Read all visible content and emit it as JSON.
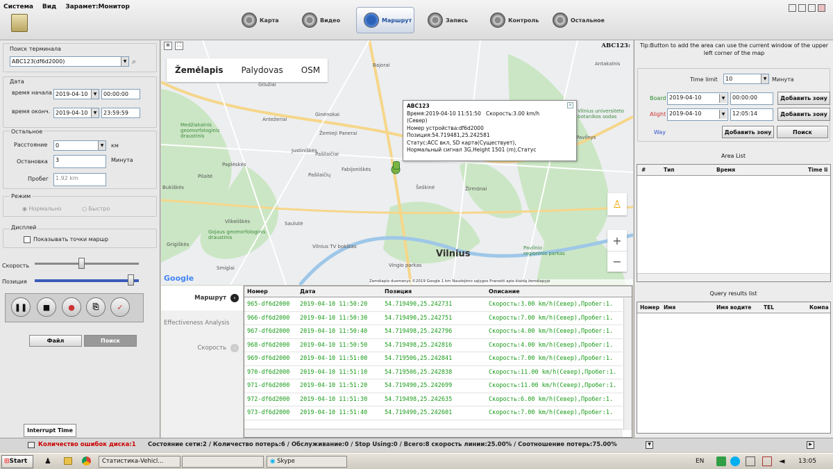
{
  "menu": {
    "items": [
      "Система",
      "Вид",
      "Зарамет:Монитор"
    ]
  },
  "nav": {
    "items": [
      {
        "label": "Карта",
        "active": false
      },
      {
        "label": "Видео",
        "active": false
      },
      {
        "label": "Маршрут",
        "active": true
      },
      {
        "label": "Запись",
        "active": false
      },
      {
        "label": "Контроль",
        "active": false
      },
      {
        "label": "Остальное",
        "active": false
      }
    ]
  },
  "left": {
    "search_label": "Поиск терминала",
    "terminal_value": "ABC123(df6d2000)",
    "date_group": "Дата",
    "start_label": "время начала",
    "start_date": "2019-04-10",
    "start_time": "00:00:00",
    "end_label": "время оконч.",
    "end_date": "2019-04-10",
    "end_time": "23:59:59",
    "other_group": "Остальное",
    "distance_label": "Расстояние",
    "distance_value": "0",
    "distance_unit": "км",
    "stop_label": "Остановка",
    "stop_value": "3",
    "stop_unit": "Минута",
    "mileage_label": "Пробег",
    "mileage_value": "1.92 km",
    "mode_group": "Режим",
    "mode_normal": "Нормально",
    "mode_fast": "Быстро",
    "display_group": "Дисплей",
    "show_points": "Показывать точки маршр",
    "speed_label": "Скорость",
    "position_label": "Позиция",
    "file_button": "Файл",
    "search_button": "Поиск",
    "interrupt_tab": "Interrupt Time"
  },
  "map": {
    "tabs": [
      "Žemėlapis",
      "Palydovas",
      "OSM"
    ],
    "vehicle_label": "ABC123:",
    "city": "Vilnius",
    "footer": "Žemėlapio duomenys ©2019 Google    1 km           Naudojimo sąlygos    Pranešti apie klaidą žemėlapyje",
    "google": "Google",
    "places": [
      "Bajorai",
      "Gilužiai",
      "Antežeriai",
      "Ginėnokai",
      "Žemieji Panerai",
      "Pašilaičiai",
      "Justiniškės",
      "Paplėskės",
      "Fabijoniškės",
      "Pilaitė",
      "Pašilaičių",
      "Bukiškės",
      "Pavilnys",
      "Vilkeliškės",
      "Šeškinė",
      "Žirmūnai",
      "Saulutė",
      "Vilnius TV bokštas",
      "Grigiškės",
      "Gojaus geomorfologinis draustinis",
      "Vingio parkas",
      "Pavilnio regioninis parkas",
      "Smiglai",
      "Medžiakalnis geomorfologinis draustinis",
      "Vilnius universiteto botanikos sodas",
      "Antakalnis"
    ],
    "popup": {
      "title": "ABC123",
      "time": "Время:2019-04-10 11:51:50",
      "speed": "Скорость:3.00 km/h",
      "dir": "(Север)",
      "device": "Номер устройства:df6d2000",
      "pos": "Позиция:54.719481,25.242581",
      "status": "Статус:ACC вкл, SD карта(Существует),",
      "signal": "Нормальный сигнал 3G,Height 1501 (m),Статус"
    }
  },
  "btabs": [
    "Маршрут",
    "Effectiveness Analysis",
    "Скорость"
  ],
  "table": {
    "headers": [
      "Номер",
      "Дата",
      "Позиция",
      "Описание"
    ],
    "rows": [
      [
        "965-df6d2000",
        "2019-04-10 11:50:20",
        "54.719490,25.242731",
        "Скорость:3.00 km/h(Север),Пробег:1."
      ],
      [
        "966-df6d2000",
        "2019-04-10 11:50:30",
        "54.719490,25.242751",
        "Скорость:7.00 km/h(Север),Пробег:1."
      ],
      [
        "967-df6d2000",
        "2019-04-10 11:50:40",
        "54.719498,25.242796",
        "Скорость:4.00 km/h(Север),Пробег:1."
      ],
      [
        "968-df6d2000",
        "2019-04-10 11:50:50",
        "54.719498,25.242816",
        "Скорость:4.00 km/h(Север),Пробег:1."
      ],
      [
        "969-df6d2000",
        "2019-04-10 11:51:00",
        "54.719506,25.242841",
        "Скорость:7.00 km/h(Север),Пробег:1."
      ],
      [
        "970-df6d2000",
        "2019-04-10 11:51:10",
        "54.719506,25.242838",
        "Скорость:11.00 km/h(Север),Пробег:1."
      ],
      [
        "971-df6d2000",
        "2019-04-10 11:51:20",
        "54.719490,25.242699",
        "Скорость:11.00 km/h(Север),Пробег:1."
      ],
      [
        "972-df6d2000",
        "2019-04-10 11:51:30",
        "54.719498,25.242635",
        "Скорость:6.00 km/h(Север),Пробег:1."
      ],
      [
        "973-df6d2000",
        "2019-04-10 11:51:40",
        "54.719490,25.242601",
        "Скорость:7.00 km/h(Север),Пробег:1."
      ]
    ]
  },
  "right": {
    "tip": "Tip:Button to add the area can use the current window of the upper left corner of the map",
    "time_limit_label": "Time limit",
    "time_limit_value": "10",
    "time_limit_unit": "Минута",
    "board_label": "Board",
    "board_date": "2019-04-10",
    "board_time": "00:00:00",
    "alight_label": "Alight",
    "alight_date": "2019-04-10",
    "alight_time": "12:05:14",
    "add_zone": "Добавить зону",
    "way_label": "Way",
    "search": "Поиск",
    "area_list_title": "Area List",
    "area_headers": [
      "#",
      "Тип",
      "Время",
      "Time li"
    ],
    "query_title": "Query results list",
    "query_headers": [
      "Номер",
      "Имя",
      "Имя водите",
      "TEL",
      "Компа"
    ]
  },
  "status": {
    "errors": "Количество ошибок диска:1",
    "rest": "Состояние сети:2 / Количество потерь:6 / Обслуживание:0 / Stop Using:0 / Всего:8    скорость линии:25.00% / Соотношение потерь:75.00%"
  },
  "taskbar": {
    "start": "Start",
    "tasks": [
      "Статистика-Vehicl...",
      "",
      "Skype"
    ],
    "lang": "EN",
    "clock": "13:05"
  },
  "colors": {
    "route": "#2e7d32",
    "popup_border": "#888888",
    "status_error": "#cc0000",
    "table_text": "#1a9b1a"
  }
}
